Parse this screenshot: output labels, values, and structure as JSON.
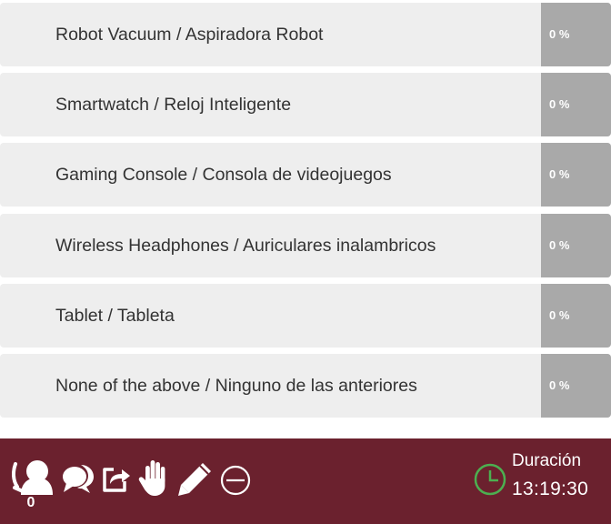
{
  "options": [
    {
      "label": "Robot Vacuum / Aspiradora Robot",
      "percent": "0 %"
    },
    {
      "label": "Smartwatch / Reloj Inteligente",
      "percent": "0 %"
    },
    {
      "label": "Gaming Console / Consola de videojuegos",
      "percent": "0 %"
    },
    {
      "label": "Wireless Headphones / Auriculares inalambricos",
      "percent": "0 %"
    },
    {
      "label": "Tablet / Tableta",
      "percent": "0 %"
    },
    {
      "label": "None of the above / Ninguno de las anteriores",
      "percent": "0 %"
    }
  ],
  "footer": {
    "participants_count": "0",
    "duration_label": "Duración",
    "duration_time": "13:19:30",
    "icons": [
      "participants-icon",
      "chat-icon",
      "share-icon",
      "raise-hand-icon",
      "pencil-icon",
      "minus-circle-icon",
      "clock-icon"
    ],
    "colors": {
      "footer_bg": "#6b212e",
      "clock": "#4caf50",
      "percent_bg": "#a9a9a9",
      "option_bg": "#eeeeee"
    }
  }
}
